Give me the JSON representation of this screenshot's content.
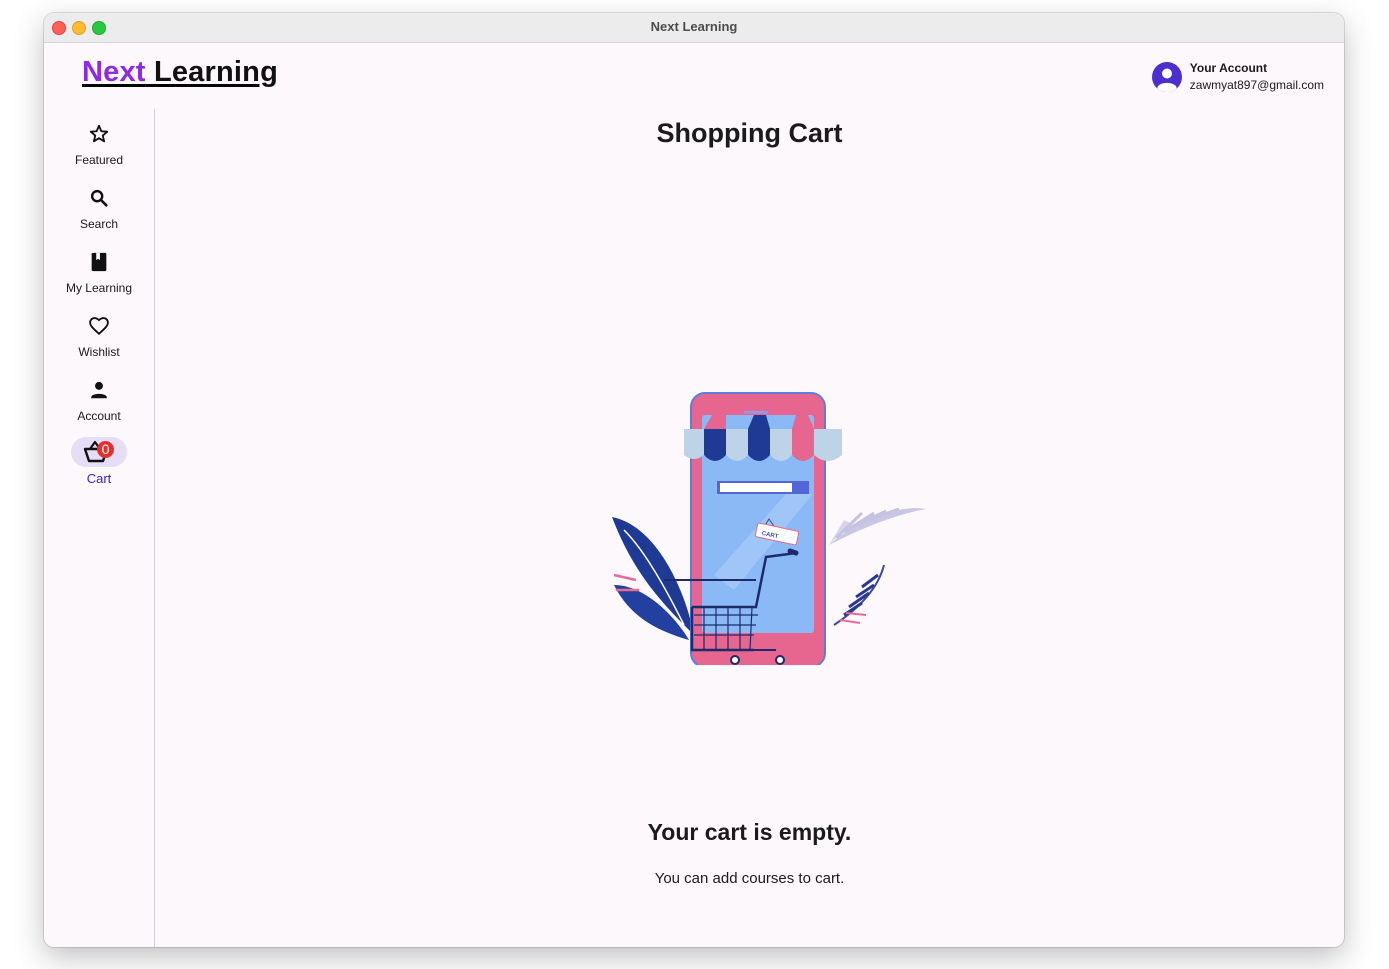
{
  "window": {
    "title": "Next Learning"
  },
  "logo": {
    "part1": "Next",
    "part2": "Learning"
  },
  "account": {
    "title": "Your Account",
    "email": "zawmyat897@gmail.com"
  },
  "nav": {
    "items": [
      {
        "label": "Featured",
        "icon": "star-outline-icon"
      },
      {
        "label": "Search",
        "icon": "search-icon"
      },
      {
        "label": "My Learning",
        "icon": "book-icon"
      },
      {
        "label": "Wishlist",
        "icon": "heart-outline-icon"
      },
      {
        "label": "Account",
        "icon": "person-icon"
      },
      {
        "label": "Cart",
        "icon": "basket-icon",
        "badge": "0",
        "active": true
      }
    ]
  },
  "main": {
    "title": "Shopping Cart",
    "empty_title": "Your cart is empty.",
    "empty_subtitle": "You can add courses to cart.",
    "illustration_tag": "CART"
  },
  "colors": {
    "accent": "#4d2fd1",
    "logo_purple": "#8c2be2",
    "badge_red": "#e3302f",
    "active_pill": "#e6ddf6"
  }
}
